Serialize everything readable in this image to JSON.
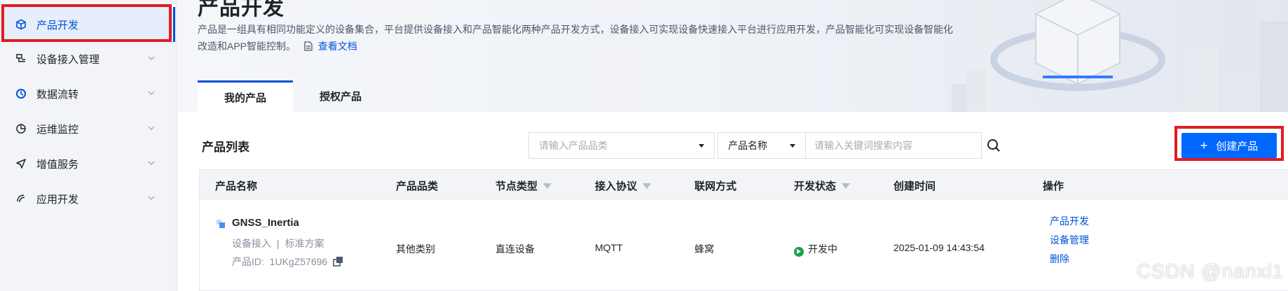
{
  "sidebar": {
    "items": [
      {
        "label": "产品开发",
        "icon": "cube-icon",
        "active": true
      },
      {
        "label": "设备接入管理",
        "icon": "device-icon"
      },
      {
        "label": "数据流转",
        "icon": "flow-icon"
      },
      {
        "label": "运维监控",
        "icon": "pie-chart-icon"
      },
      {
        "label": "增值服务",
        "icon": "send-icon"
      },
      {
        "label": "应用开发",
        "icon": "app-icon"
      }
    ]
  },
  "header": {
    "title": "产品开发",
    "description": "产品是一组具有相同功能定义的设备集合，平台提供设备接入和产品智能化两种产品开发方式，设备接入可实现设备快速接入平台进行应用开发，产品智能化可实现设备智能化改造和APP智能控制。",
    "doc_link": "查看文档",
    "tabs": [
      {
        "label": "我的产品",
        "active": true
      },
      {
        "label": "授权产品"
      }
    ]
  },
  "toolbar": {
    "list_title": "产品列表",
    "category_placeholder": "请输入产品品类",
    "field_select": "产品名称",
    "keyword_placeholder": "请输入关键词搜索内容",
    "create_label": "创建产品"
  },
  "table": {
    "columns": [
      "产品名称",
      "产品品类",
      "节点类型",
      "接入协议",
      "联网方式",
      "开发状态",
      "创建时间",
      "操作"
    ],
    "rows": [
      {
        "name": "GNSS_Inertia",
        "access": "设备接入",
        "scheme": "标准方案",
        "id_label": "产品ID:",
        "id": "1UKgZ57696",
        "category": "其他类别",
        "node_type": "直连设备",
        "protocol": "MQTT",
        "network": "蜂窝",
        "status": "开发中",
        "created": "2025-01-09 14:43:54",
        "ops": [
          "产品开发",
          "设备管理",
          "删除"
        ]
      }
    ]
  },
  "watermark": "CSDN @nanxl1",
  "colors": {
    "primary": "#0052d9",
    "button": "#0068ff",
    "highlight": "#e21c22",
    "status": "#16a34a"
  }
}
